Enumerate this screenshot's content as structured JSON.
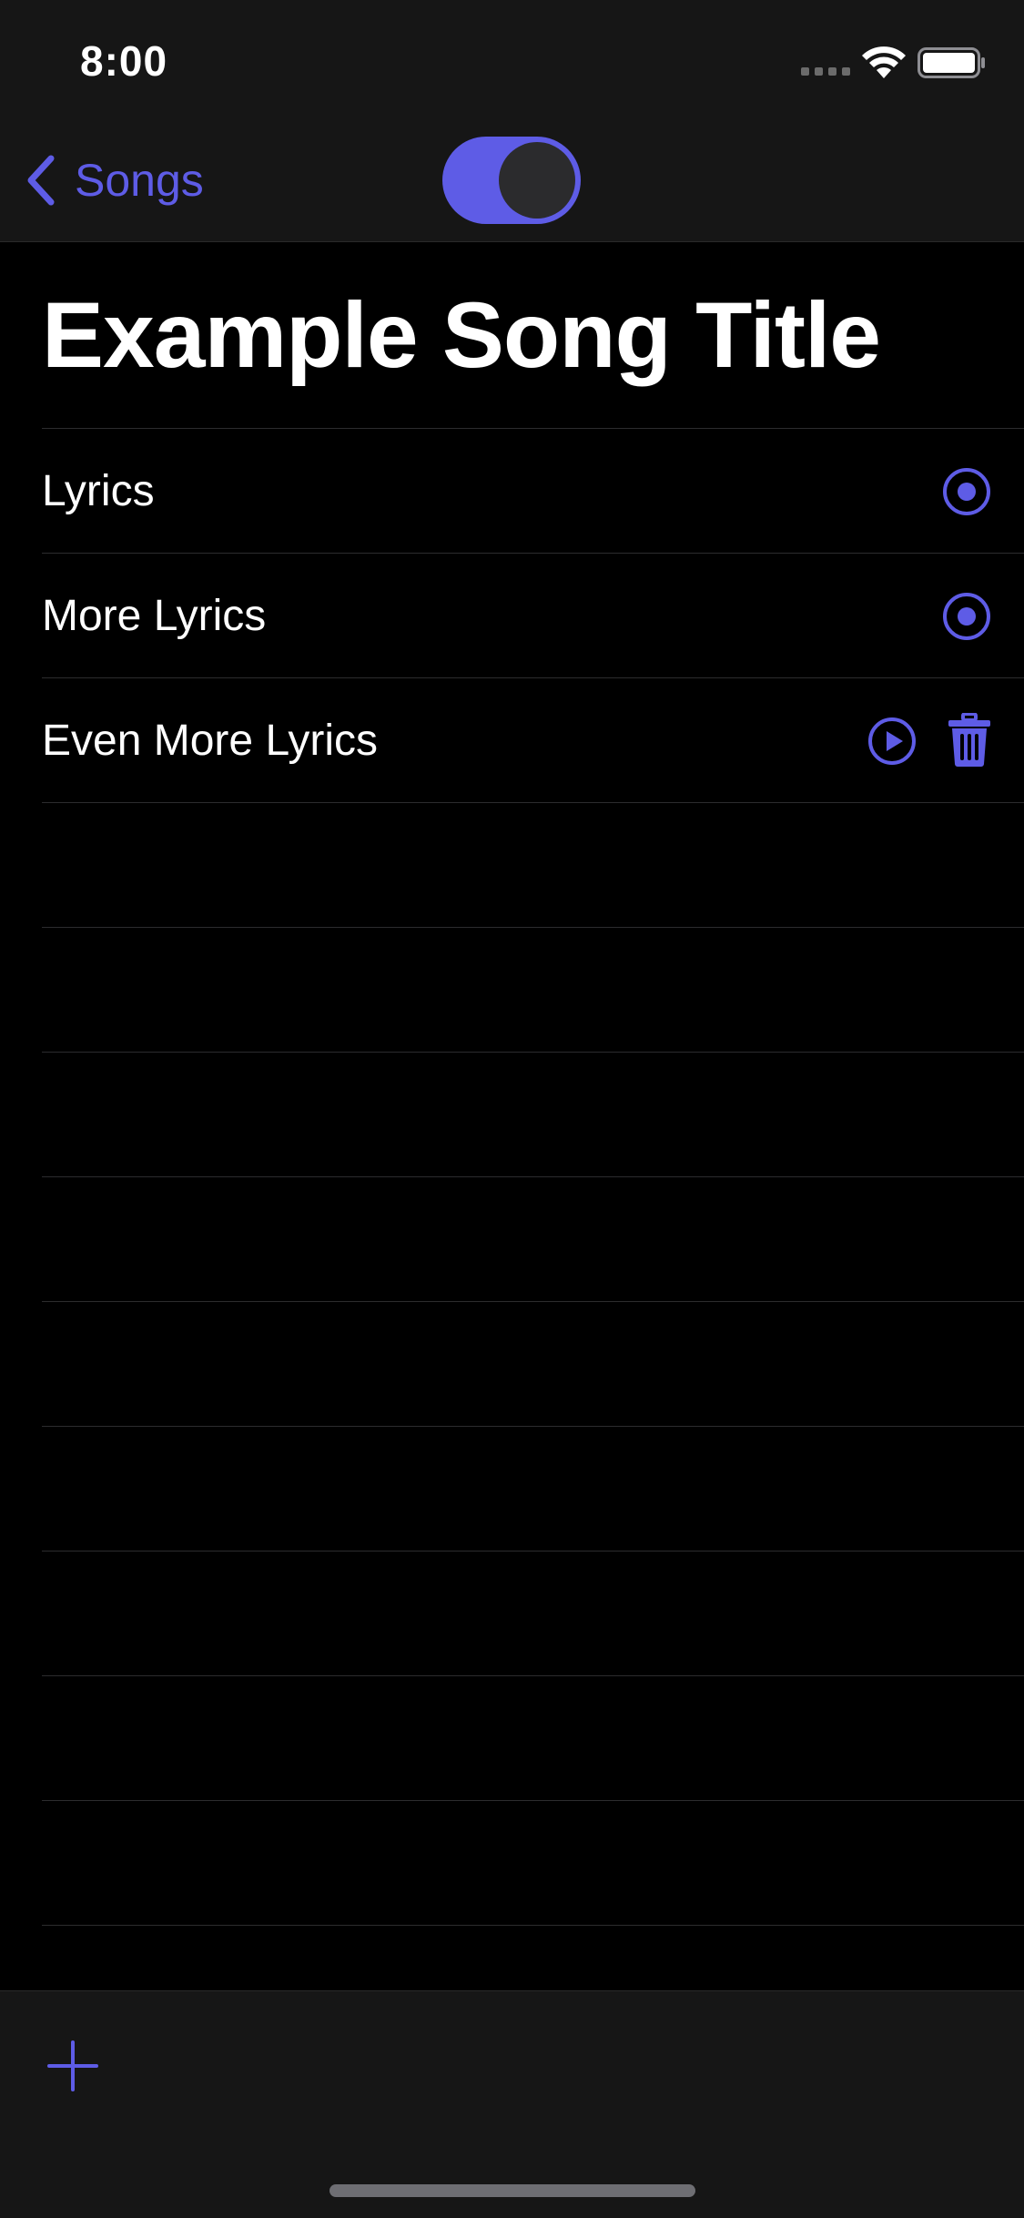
{
  "status_bar": {
    "time": "8:00",
    "icons": [
      "signal-icon",
      "wifi-icon",
      "battery-icon"
    ]
  },
  "nav": {
    "back_label": "Songs",
    "back_icon": "chevron-left-icon",
    "toggle_on": true
  },
  "song": {
    "title": "Example Song Title",
    "rows": [
      {
        "label": "Lyrics",
        "icons": [
          "radio-selected-icon"
        ]
      },
      {
        "label": "More Lyrics",
        "icons": [
          "radio-selected-icon"
        ]
      },
      {
        "label": "Even More Lyrics",
        "icons": [
          "play-icon",
          "trash-icon"
        ]
      }
    ]
  },
  "toolbar": {
    "add_icon": "plus-icon"
  },
  "colors": {
    "accent": "#5e5ce6",
    "background": "#000000",
    "bar_background": "#161616",
    "separator": "#2c2c2e"
  }
}
